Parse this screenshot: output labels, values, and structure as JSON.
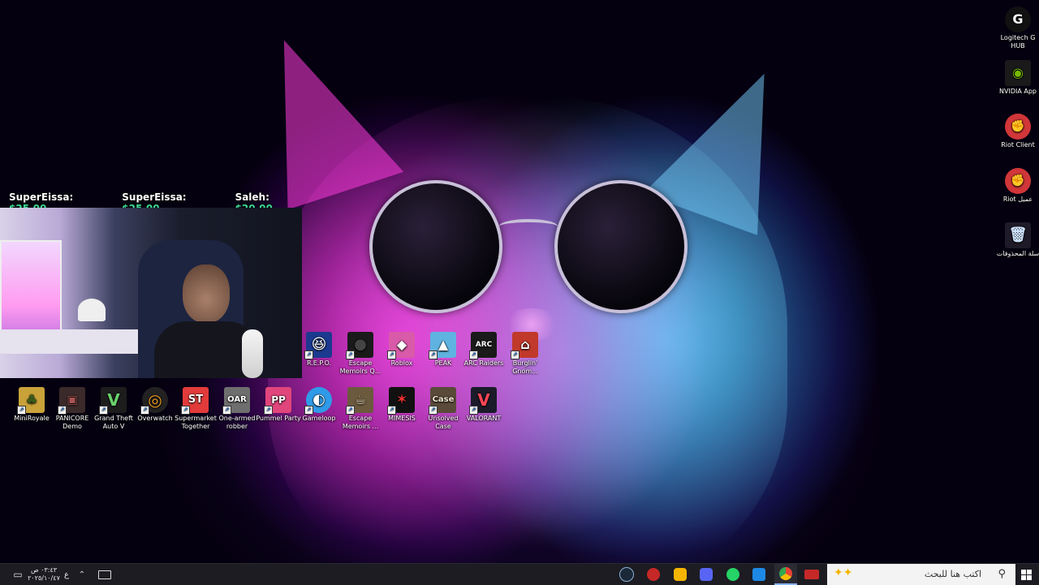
{
  "donations": [
    {
      "name": "SuperEissa:",
      "amount": "$25.00"
    },
    {
      "name": "SuperEissa:",
      "amount": "$25.00"
    },
    {
      "name": "Saleh:",
      "amount": "$20.00"
    }
  ],
  "desktop": {
    "right_column": [
      {
        "label": "Logitech G HUB",
        "icon": "logitech-g-icon",
        "glyph": "G",
        "color": "#111111"
      },
      {
        "label": "NVIDIA App",
        "icon": "nvidia-icon",
        "glyph": "◉",
        "color": "#76b900"
      },
      {
        "label": "Riot Client",
        "icon": "riot-icon",
        "glyph": "✊",
        "color": "#d13639"
      },
      {
        "label": "Riot عميل",
        "icon": "riot-icon",
        "glyph": "✊",
        "color": "#d13639"
      },
      {
        "label": "سلة المحذوفات",
        "icon": "recycle-bin-icon",
        "glyph": "🗑",
        "color": "#8fb8e8"
      }
    ],
    "row1": [
      {
        "label": "R.E.P.O.",
        "icon": "repo-icon",
        "glyph": "😆",
        "color": "#1b3a8f"
      },
      {
        "label": "Escape Memoirs Q...",
        "icon": "escape-memoirs-icon",
        "glyph": "●",
        "color": "#1a1a1a"
      },
      {
        "label": "Roblox",
        "icon": "roblox-icon",
        "glyph": "◆",
        "color": "#d95aa8"
      },
      {
        "label": "PEAK",
        "icon": "peak-icon",
        "glyph": "▲",
        "color": "#5fb3e0"
      },
      {
        "label": "ARC Raiders",
        "icon": "arc-raiders-icon",
        "glyph": "ARC",
        "color": "#1a1a1a"
      },
      {
        "label": "Burglin' Gnom...",
        "icon": "burglin-gnomes-icon",
        "glyph": "⌂",
        "color": "#c0392b"
      }
    ],
    "row2": [
      {
        "label": "MiniRoyale",
        "icon": "miniroyale-icon",
        "glyph": "♣",
        "color": "#c9a23a"
      },
      {
        "label": "PANICORE Demo",
        "icon": "panicore-icon",
        "glyph": "▣",
        "color": "#3b2a2a"
      },
      {
        "label": "Grand Theft Auto V",
        "icon": "gta-v-icon",
        "glyph": "V",
        "color": "#1d1d1d"
      },
      {
        "label": "Overwatch",
        "icon": "overwatch-icon",
        "glyph": "◎",
        "color": "#f29b1d"
      },
      {
        "label": "Supermarket Together",
        "icon": "supermarket-together-icon",
        "glyph": "ST",
        "color": "#e23b3b"
      },
      {
        "label": "One-armed robber",
        "icon": "one-armed-robber-icon",
        "glyph": "OAR",
        "color": "#6e6e6e"
      },
      {
        "label": "Pummel Party",
        "icon": "pummel-party-icon",
        "glyph": "PP",
        "color": "#e0457b"
      },
      {
        "label": "Gameloop",
        "icon": "gameloop-icon",
        "glyph": "◐",
        "color": "#2f9be8"
      },
      {
        "label": "Escape Memoirs ...",
        "icon": "escape-memoirs-mug-icon",
        "glyph": "☕",
        "color": "#6b5a3e"
      },
      {
        "label": "MIMESIS",
        "icon": "mimesis-icon",
        "glyph": "✶",
        "color": "#b22222"
      },
      {
        "label": "Unsolved Case",
        "icon": "unsolved-case-icon",
        "glyph": "Case",
        "color": "#5a4a3a"
      },
      {
        "label": "VALORANT",
        "icon": "valorant-icon",
        "glyph": "V",
        "color": "#ff4655"
      }
    ]
  },
  "taskbar": {
    "time": "٠٣:٤٣ ص",
    "date": "٢٠٢٥/١٠/٤٧",
    "lang": "ع",
    "search_placeholder": "اكتب هنا للبحث",
    "apps": [
      {
        "icon": "steam-icon",
        "color": "#1b2838"
      },
      {
        "icon": "obs-icon",
        "color": "#c62828"
      },
      {
        "icon": "discord-yellow-icon",
        "color": "#f4b400"
      },
      {
        "icon": "discord-icon",
        "color": "#5865f2"
      },
      {
        "icon": "whatsapp-icon",
        "color": "#25d366"
      },
      {
        "icon": "mail-icon",
        "color": "#1e88e5"
      },
      {
        "icon": "chrome-icon",
        "color": "#4285f4"
      },
      {
        "icon": "media-app-icon",
        "color": "#c62828"
      }
    ]
  }
}
